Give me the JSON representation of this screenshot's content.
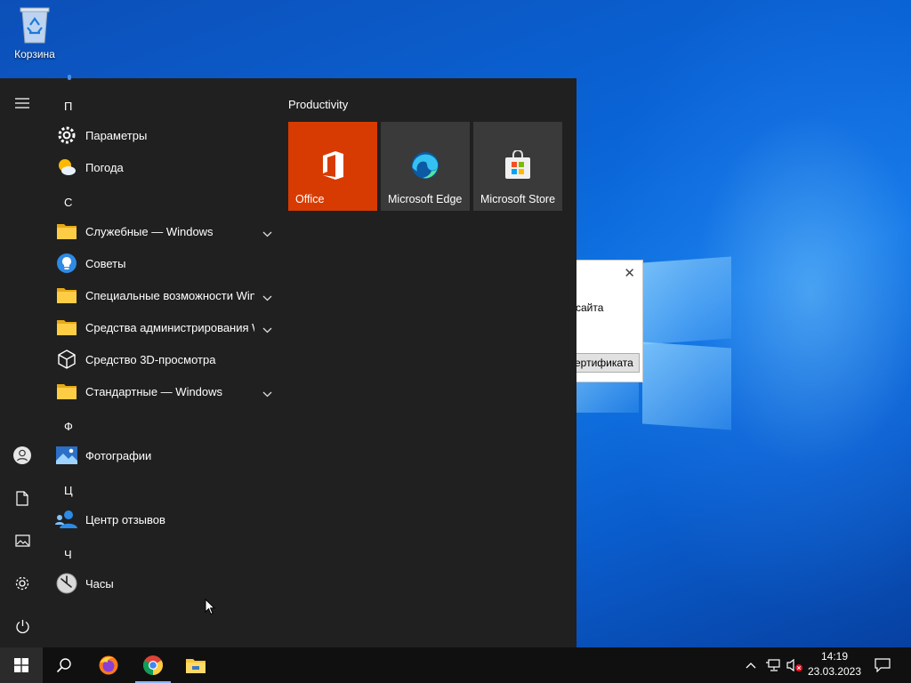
{
  "desktop": {
    "recycle_bin_label": "Корзина"
  },
  "dialog": {
    "text": "о сайта",
    "button_label": "сертификата"
  },
  "start_menu": {
    "app_list": [
      {
        "type": "letter",
        "text": "П"
      },
      {
        "type": "app",
        "label": "Параметры",
        "icon": "settings-gear-icon",
        "expandable": false
      },
      {
        "type": "app",
        "label": "Погода",
        "icon": "weather-icon",
        "expandable": false
      },
      {
        "type": "letter",
        "text": "С"
      },
      {
        "type": "app",
        "label": "Служебные — Windows",
        "icon": "folder-icon",
        "expandable": true
      },
      {
        "type": "app",
        "label": "Советы",
        "icon": "tips-lightbulb-icon",
        "expandable": false
      },
      {
        "type": "app",
        "label": "Специальные возможности Win...",
        "icon": "folder-icon",
        "expandable": true
      },
      {
        "type": "app",
        "label": "Средства администрирования W...",
        "icon": "folder-icon",
        "expandable": true
      },
      {
        "type": "app",
        "label": "Средство 3D-просмотра",
        "icon": "3d-cube-icon",
        "expandable": false
      },
      {
        "type": "app",
        "label": "Стандартные — Windows",
        "icon": "folder-icon",
        "expandable": true
      },
      {
        "type": "letter",
        "text": "Ф"
      },
      {
        "type": "app",
        "label": "Фотографии",
        "icon": "photos-icon",
        "expandable": false
      },
      {
        "type": "letter",
        "text": "Ц"
      },
      {
        "type": "app",
        "label": "Центр отзывов",
        "icon": "feedback-hub-icon",
        "expandable": false
      },
      {
        "type": "letter",
        "text": "Ч"
      },
      {
        "type": "app",
        "label": "Часы",
        "icon": "clock-icon",
        "expandable": false
      }
    ],
    "tile_group": {
      "title": "Productivity",
      "tiles": [
        {
          "label": "Office",
          "color": "#d83b01",
          "icon": "office-icon"
        },
        {
          "label": "Microsoft Edge",
          "color": "#3a3a3a",
          "icon": "edge-icon"
        },
        {
          "label": "Microsoft Store",
          "color": "#3a3a3a",
          "icon": "store-icon"
        }
      ]
    }
  },
  "taskbar": {
    "time": "14:19",
    "date": "23.03.2023"
  }
}
